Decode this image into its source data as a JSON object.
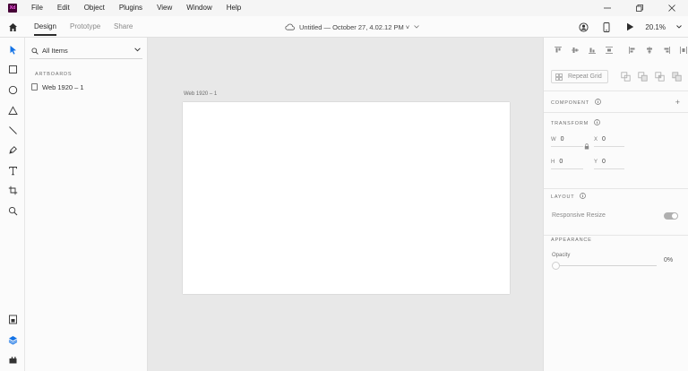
{
  "app": {
    "logo_text": "Xd"
  },
  "menu": [
    "File",
    "Edit",
    "Object",
    "Plugins",
    "View",
    "Window",
    "Help"
  ],
  "modes": [
    {
      "label": "Design",
      "active": true
    },
    {
      "label": "Prototype",
      "active": false
    },
    {
      "label": "Share",
      "active": false
    }
  ],
  "document": {
    "title": "Untitled — October 27, 4.02.12 PM ˅"
  },
  "zoom": {
    "level": "20.1%"
  },
  "tools": [
    "select-tool",
    "rectangle-tool",
    "ellipse-tool",
    "polygon-tool",
    "line-tool",
    "pen-tool",
    "text-tool",
    "artboard-tool",
    "zoom-tool"
  ],
  "bottom_tools": [
    "document-assets",
    "layers",
    "plugins"
  ],
  "layers_panel": {
    "filter_label": "All Items",
    "artboards_heading": "ARTBOARDS",
    "artboards": [
      "Web 1920 – 1"
    ]
  },
  "canvas": {
    "artboard_name": "Web 1920 – 1",
    "artboard_color": "#ffffff",
    "background_color": "#e8e8e8"
  },
  "inspector": {
    "repeat_grid_label": "Repeat Grid",
    "component_heading": "COMPONENT",
    "component_add": "+",
    "transform_heading": "TRANSFORM",
    "w_label": "W",
    "w_value": "0",
    "x_label": "X",
    "x_value": "0",
    "h_label": "H",
    "h_value": "0",
    "y_label": "Y",
    "y_value": "0",
    "layout_heading": "LAYOUT",
    "responsive_resize_label": "Responsive Resize",
    "appearance_heading": "APPEARANCE",
    "opacity_label": "Opacity",
    "opacity_value": "0%"
  },
  "colors": {
    "accent": "#1473e6",
    "brand": "#470137",
    "brand_text": "#ff61f6"
  }
}
